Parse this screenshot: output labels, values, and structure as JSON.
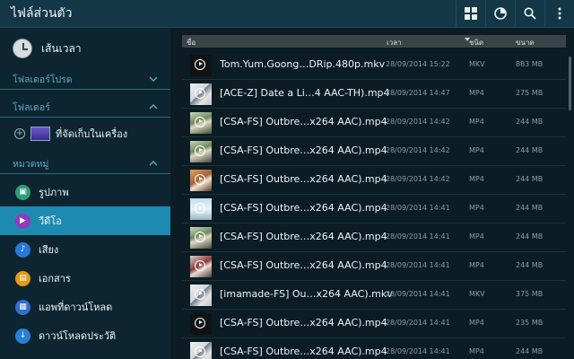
{
  "app": {
    "title": "ไฟล์ส่วนตัว",
    "actions": [
      {
        "icon": "grid-view-icon",
        "name": "view-grid-button"
      },
      {
        "icon": "storage-usage-icon",
        "name": "storage-usage-button"
      },
      {
        "icon": "search-icon",
        "name": "search-button"
      },
      {
        "icon": "more-options-icon",
        "name": "overflow-menu-button"
      }
    ]
  },
  "sidebar": {
    "recent_label": "เส้นเวลา",
    "favorites_header": "โฟลเดอร์โปรด",
    "folders_header": "โฟลเดอร์",
    "storage_label": "ที่จัดเก็บในเครื่อง",
    "categories_header": "หมวดหมู่",
    "categories": [
      {
        "label": "รูปภาพ",
        "icon": "image-icon",
        "color": "#2e9e77",
        "active": false
      },
      {
        "label": "วีดีโอ",
        "icon": "video-icon",
        "color": "#8e3bbf",
        "active": true
      },
      {
        "label": "เสียง",
        "icon": "music-icon",
        "color": "#2a78d6",
        "active": false
      },
      {
        "label": "เอกสาร",
        "icon": "document-icon",
        "color": "#e09a1a",
        "active": false
      },
      {
        "label": "แอพที่ดาวน์โหลด",
        "icon": "apps-icon",
        "color": "#2f6fd0",
        "active": false
      },
      {
        "label": "ดาวน์โหลดประวัติ",
        "icon": "download-icon",
        "color": "#2a7fd4",
        "active": false
      }
    ]
  },
  "list": {
    "columns": {
      "name": "ชื่อ",
      "time": "เวลา",
      "type": "ชนิด",
      "size": "ขนาด"
    },
    "rows": [
      {
        "name": "Tom.Yum.Goong…DRip.480p.mkv",
        "date": "28/09/2014 15:22",
        "type": "MKV",
        "size": "883 MB",
        "thumb": "dark"
      },
      {
        "name": "[ACE-Z] Date a Li…4 AAC-TH).mp4",
        "date": "28/09/2014 14:47",
        "type": "MP4",
        "size": "275 MB",
        "thumb": "anime-light"
      },
      {
        "name": "[CSA-FS] Outbre…x264 AAC).mp4",
        "date": "28/09/2014 14:42",
        "type": "MP4",
        "size": "244 MB",
        "thumb": "anime-green"
      },
      {
        "name": "[CSA-FS] Outbre…x264 AAC).mp4",
        "date": "28/09/2014 14:42",
        "type": "MP4",
        "size": "244 MB",
        "thumb": "anime-green"
      },
      {
        "name": "[CSA-FS] Outbre…x264 AAC).mp4",
        "date": "28/09/2014 14:42",
        "type": "MP4",
        "size": "244 MB",
        "thumb": "anime-orange"
      },
      {
        "name": "[CSA-FS] Outbre…x264 AAC).mp4",
        "date": "28/09/2014 14:41",
        "type": "MP4",
        "size": "244 MB",
        "thumb": "anime-sky"
      },
      {
        "name": "[CSA-FS] Outbre…x264 AAC).mp4",
        "date": "28/09/2014 14:41",
        "type": "MP4",
        "size": "244 MB",
        "thumb": "anime-green"
      },
      {
        "name": "[CSA-FS] Outbre…x264 AAC).mp4",
        "date": "28/09/2014 14:41",
        "type": "MP4",
        "size": "244 MB",
        "thumb": "anime-red"
      },
      {
        "name": "[imamade-FS] Ou…x264 AAC).mkv",
        "date": "28/09/2014 14:41",
        "type": "MKV",
        "size": "375 MB",
        "thumb": "anime-light"
      },
      {
        "name": "[CSA-FS] Outbre…x264 AAC).mp4",
        "date": "28/09/2014 14:41",
        "type": "MP4",
        "size": "235 MB",
        "thumb": "dark"
      },
      {
        "name": "[CSA-FS] Outbre…x264 AAC).mp4",
        "date": "28/09/2014 14:41",
        "type": "MP4",
        "size": "244 MB",
        "thumb": "anime-light"
      }
    ]
  }
}
